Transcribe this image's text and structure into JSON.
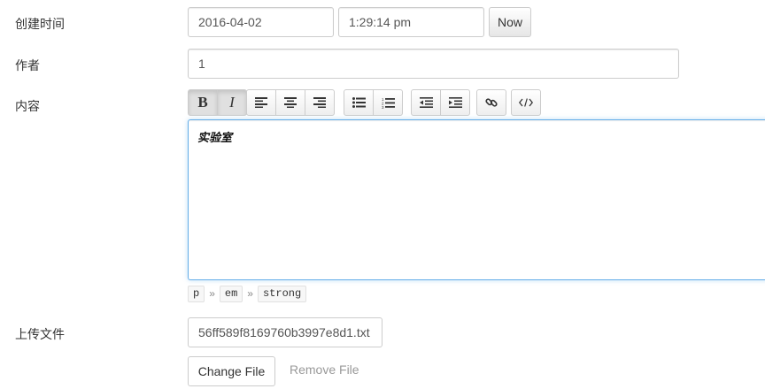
{
  "fields": {
    "created_time": {
      "label": "创建时间",
      "date_value": "2016-04-02",
      "time_value": "1:29:14 pm",
      "now_button": "Now"
    },
    "author": {
      "label": "作者",
      "value": "1"
    },
    "content": {
      "label": "内容",
      "editor_text": "实验室",
      "path": [
        "p",
        "em",
        "strong"
      ],
      "path_separator": "»",
      "toolbar": {
        "bold_label": "B",
        "italic_label": "I",
        "icons": [
          "align-left-icon",
          "align-center-icon",
          "align-right-icon",
          "bullet-list-icon",
          "numbered-list-icon",
          "outdent-icon",
          "indent-icon",
          "link-icon",
          "code-view-icon"
        ]
      }
    },
    "upload": {
      "label": "上传文件",
      "filename": "56ff589f8169760b3997e8d1.txt",
      "change_button": "Change File",
      "remove_link": "Remove File"
    }
  },
  "colors": {
    "focus_border": "#66afe9",
    "border": "#cccccc",
    "muted_text": "#999999"
  }
}
